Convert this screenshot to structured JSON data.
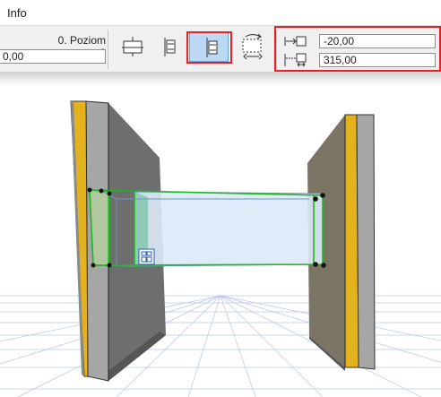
{
  "window": {
    "title": "Info"
  },
  "info_panel": {
    "story_label": "0. Poziom 0",
    "elevation_value": "0,00",
    "offset_1_value": "-20,00",
    "offset_2_value": "315,00"
  },
  "colors": {
    "highlight_red": "#e2232a",
    "active_button_fill": "#bcd8f4",
    "selection_green": "#1db81d",
    "glass_fill": "#dbe9f7",
    "wall_core": "#a6a6a6",
    "wall_finish": "#e4b21d",
    "grid_line": "#b8c6e8"
  }
}
